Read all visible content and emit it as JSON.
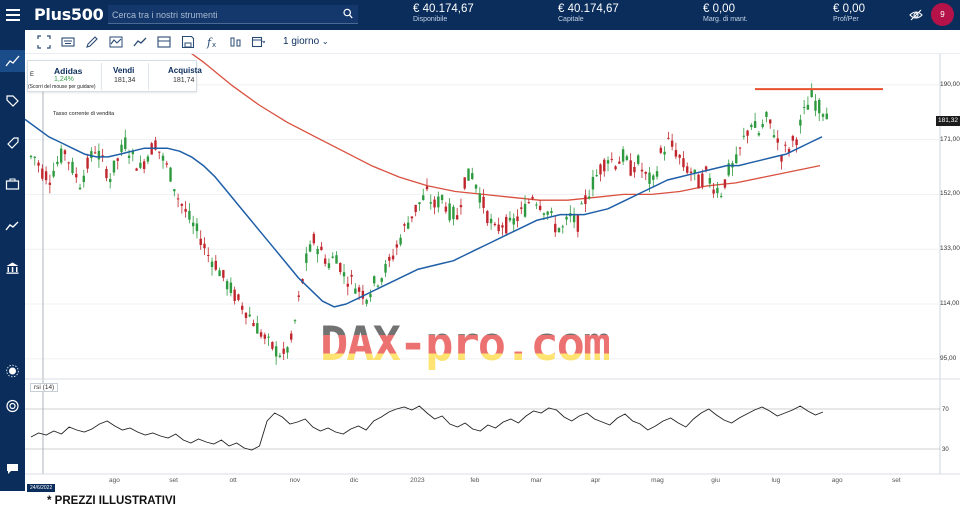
{
  "topbar": {
    "logo": "Plus500",
    "search_placeholder": "Cerca tra i nostri strumenti",
    "metrics": [
      {
        "value": "€ 40.174,67",
        "label": "Disponibile"
      },
      {
        "value": "€ 40.174,67",
        "label": "Capitale"
      },
      {
        "value": "€ 0,00",
        "label": "Marg. di mant."
      },
      {
        "value": "€ 0,00",
        "label": "Prof/Per"
      }
    ],
    "notification_count": "9"
  },
  "toolbar": {
    "timeframe": "1 giorno"
  },
  "quote": {
    "exchange_label": "E",
    "symbol": "Adidas",
    "change": "1,24%",
    "sell_label": "Vendi",
    "sell_value": "181,34",
    "buy_label": "Acquista",
    "buy_value": "181,74",
    "hint": "(Scorri del mouse per guidare)"
  },
  "chart_note": "Tasso corrente di vendita",
  "indicator_label": "rsi (14)",
  "current_price_tag": "181,32",
  "date_tag": "24/6/2022",
  "watermark": "DAX-pro.com",
  "footnote": "* PREZZI ILLUSTRATIVI",
  "colors": {
    "brand_navy": "#0a2d5c",
    "candle_up": "#2e9a3f",
    "candle_down": "#c0262d",
    "ma_short": "#1f5fa8",
    "ma_long": "#d9503f",
    "resistance": "#e8502f"
  },
  "chart_data": [
    {
      "type": "candlestick",
      "yaxis_ticks": [
        95.0,
        114.0,
        133.0,
        152.0,
        171.0,
        190.0
      ],
      "ylim": [
        88,
        200
      ],
      "x_ticks": [
        "ago",
        "set",
        "ott",
        "nov",
        "dic",
        "2023",
        "feb",
        "mar",
        "apr",
        "mag",
        "giu",
        "lug",
        "ago",
        "set"
      ],
      "price_path": [
        165,
        160,
        158,
        163,
        167,
        161,
        156,
        162,
        168,
        163,
        158,
        164,
        170,
        165,
        161,
        166,
        170,
        164,
        159,
        151,
        146,
        141,
        137,
        131,
        128,
        123,
        119,
        115,
        112,
        108,
        104,
        100,
        98,
        96,
        101,
        115,
        129,
        136,
        132,
        128,
        131,
        124,
        122,
        119,
        117,
        121,
        124,
        128,
        134,
        140,
        145,
        149,
        152,
        148,
        151,
        146,
        144,
        157,
        159,
        152,
        145,
        139,
        142,
        141,
        144,
        147,
        152,
        149,
        146,
        141,
        140,
        144,
        142,
        150,
        156,
        161,
        165,
        163,
        165,
        161,
        163,
        158,
        156,
        166,
        170,
        167,
        162,
        160,
        156,
        159,
        155,
        153,
        160,
        163,
        171,
        177,
        173,
        178,
        174,
        166,
        168,
        172,
        180,
        186,
        182,
        181
      ],
      "ma_short": [
        178,
        175,
        172,
        170,
        168,
        166,
        165,
        165,
        166,
        167,
        168,
        168,
        168,
        167,
        165,
        162,
        158,
        153,
        148,
        143,
        138,
        133,
        128,
        123,
        119,
        115,
        113,
        114,
        116,
        118,
        120,
        122,
        124,
        126,
        127,
        128,
        129,
        131,
        133,
        135,
        137,
        139,
        141,
        143,
        144,
        145,
        145,
        145,
        146,
        147,
        149,
        151,
        153,
        155,
        157,
        158,
        159,
        160,
        161,
        162,
        162,
        163,
        164,
        165,
        166,
        168,
        170,
        172
      ],
      "ma_long": [
        205,
        198,
        190,
        183,
        177,
        172,
        167,
        162,
        158,
        155,
        153,
        152,
        151,
        150,
        150,
        151,
        152,
        152,
        153,
        155,
        156,
        158,
        160,
        162
      ],
      "resistance_level": 188.5,
      "rsi": {
        "label": "rsi (14)",
        "levels": [
          30,
          70
        ],
        "values": [
          42,
          46,
          44,
          48,
          45,
          52,
          49,
          47,
          50,
          55,
          58,
          53,
          49,
          51,
          47,
          44,
          46,
          43,
          41,
          45,
          39,
          36,
          40,
          37,
          35,
          39,
          33,
          36,
          31,
          29,
          33,
          58,
          66,
          62,
          55,
          57,
          60,
          52,
          48,
          51,
          47,
          45,
          50,
          53,
          49,
          58,
          62,
          67,
          70,
          72,
          69,
          73,
          66,
          60,
          63,
          55,
          52,
          56,
          50,
          48,
          54,
          51,
          57,
          60,
          56,
          63,
          68,
          66,
          71,
          69,
          62,
          58,
          63,
          66,
          60,
          57,
          54,
          61,
          65,
          58,
          55,
          49,
          53,
          58,
          61,
          56,
          52,
          60,
          66,
          70,
          64,
          59,
          56,
          61,
          65,
          69,
          72,
          68,
          63,
          66,
          69,
          73,
          68,
          64,
          67
        ]
      }
    }
  ]
}
